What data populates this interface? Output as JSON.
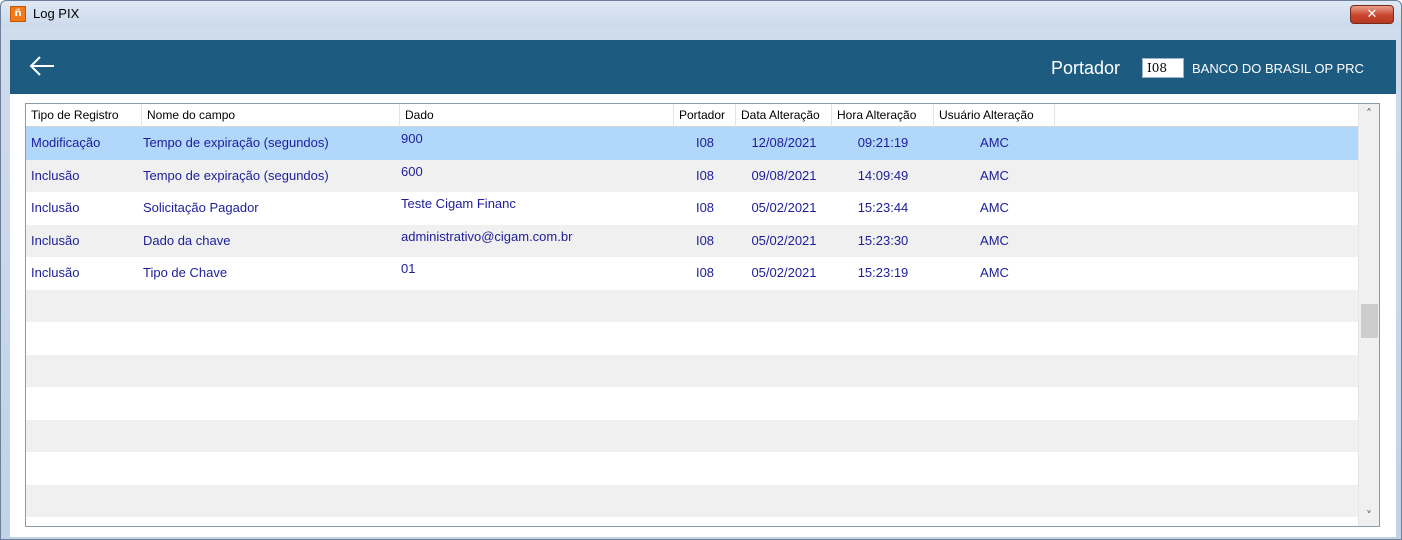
{
  "window": {
    "title": "Log PIX",
    "icon": "app-logo-icon",
    "close_icon": "close-icon"
  },
  "header": {
    "portador_label": "Portador",
    "portador_code": "I08",
    "portador_name": "BANCO DO BRASIL OP PRC",
    "bg_color": "#1d5c80"
  },
  "grid": {
    "columns": [
      "Tipo de Registro",
      "Nome do campo",
      "Dado",
      "Portador",
      "Data Alteração",
      "Hora Alteração",
      "Usuário Alteração"
    ],
    "rows": [
      {
        "tipo": "Modificação",
        "campo": "Tempo de expiração (segundos)",
        "dado": "900",
        "portador": "I08",
        "data": "12/08/2021",
        "hora": "09:21:19",
        "usuario": "AMC"
      },
      {
        "tipo": "Inclusão",
        "campo": "Tempo de expiração (segundos)",
        "dado": "600",
        "portador": "I08",
        "data": "09/08/2021",
        "hora": "14:09:49",
        "usuario": "AMC"
      },
      {
        "tipo": "Inclusão",
        "campo": "Solicitação Pagador",
        "dado": "Teste Cigam Financ",
        "portador": "I08",
        "data": "05/02/2021",
        "hora": "15:23:44",
        "usuario": "AMC"
      },
      {
        "tipo": "Inclusão",
        "campo": "Dado da chave",
        "dado": "administrativo@cigam.com.br",
        "portador": "I08",
        "data": "05/02/2021",
        "hora": "15:23:30",
        "usuario": "AMC"
      },
      {
        "tipo": "Inclusão",
        "campo": "Tipo de Chave",
        "dado": "01",
        "portador": "I08",
        "data": "05/02/2021",
        "hora": "15:23:19",
        "usuario": "AMC"
      }
    ],
    "selected_row_color": "#b1d7fb",
    "text_color": "#1d1d9a"
  },
  "scrollbar": {
    "up_icon": "chevron-up-icon",
    "down_icon": "chevron-down-icon"
  }
}
